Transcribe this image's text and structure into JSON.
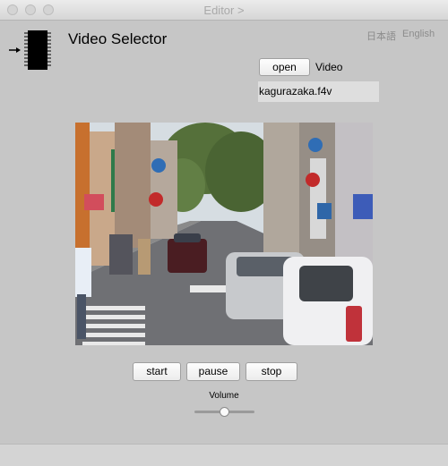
{
  "window": {
    "title": "Editor >"
  },
  "header": {
    "app_title": "Video Selector"
  },
  "language": {
    "japanese": "日本語",
    "english": "English"
  },
  "file": {
    "open_label": "open",
    "video_label": "Video",
    "filename": "kagurazaka.f4v"
  },
  "controls": {
    "start_label": "start",
    "pause_label": "pause",
    "stop_label": "stop"
  },
  "volume": {
    "label": "Volume",
    "level_fraction": 0.5
  },
  "icons": {
    "app_icon": "chip-input-icon"
  }
}
